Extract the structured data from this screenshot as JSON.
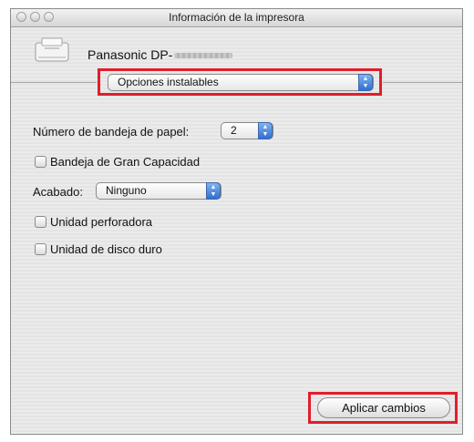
{
  "window": {
    "title": "Información de la impresora"
  },
  "printer": {
    "name": "Panasonic DP-"
  },
  "options_popup": {
    "selected": "Opciones instalables"
  },
  "tray": {
    "label": "Número de bandeja de papel:",
    "selected": "2"
  },
  "checkboxes": {
    "large_capacity": "Bandeja de Gran Capacidad",
    "punch_unit": "Unidad perforadora",
    "hard_disk": "Unidad de disco duro"
  },
  "finishing": {
    "label": "Acabado:",
    "selected": "Ninguno"
  },
  "apply_button": {
    "label": "Aplicar cambios"
  },
  "colors": {
    "highlight": "#e01e2c",
    "popup_arrow": "#2f6fd3"
  }
}
